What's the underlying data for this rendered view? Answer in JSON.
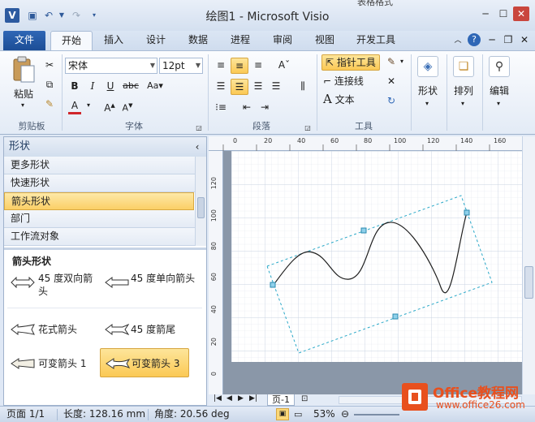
{
  "window": {
    "title": "绘图1 - Microsoft Visio",
    "context_tab_partial": "表格格式"
  },
  "tabs": [
    "文件",
    "开始",
    "插入",
    "设计",
    "数据",
    "进程",
    "审阅",
    "视图",
    "开发工具"
  ],
  "ribbon": {
    "clipboard": {
      "paste": "粘贴",
      "label": "剪贴板"
    },
    "font": {
      "name": "宋体",
      "size": "12pt",
      "label": "字体"
    },
    "paragraph": {
      "label": "段落"
    },
    "tools": {
      "pointer": "指针工具",
      "connector": "连接线",
      "text": "文本",
      "label": "工具"
    },
    "shape": {
      "label": "形状"
    },
    "arrange": {
      "label": "排列"
    },
    "edit": {
      "label": "编辑"
    }
  },
  "shapes_panel": {
    "title": "形状",
    "stencils": [
      "更多形状",
      "快速形状",
      "箭头形状",
      "部门",
      "工作流对象"
    ],
    "selected_stencil": "箭头形状",
    "section_title": "箭头形状",
    "items": [
      {
        "label": "45 度双向箭头"
      },
      {
        "label": "45 度单向箭头"
      },
      {
        "label": "花式箭头"
      },
      {
        "label": "45 度箭尾"
      },
      {
        "label": "可变箭头 1"
      },
      {
        "label": "可变箭头 3"
      }
    ]
  },
  "ruler": {
    "top": [
      "0",
      "20",
      "40",
      "60",
      "80",
      "100",
      "120",
      "140",
      "160"
    ],
    "left": [
      "120",
      "100",
      "80",
      "60",
      "40",
      "20",
      "0"
    ]
  },
  "page_tab": "页-1",
  "status": {
    "page": "页面 1/1",
    "length": "长度: 128.16 mm",
    "angle": "角度: 20.56 deg",
    "zoom": "53%"
  },
  "watermark": {
    "brand": "Office教程网",
    "url": "www.office26.com"
  },
  "colors": {
    "accent": "#2f67b6",
    "selection": "#fbcf66",
    "office_orange": "#e8501e"
  }
}
